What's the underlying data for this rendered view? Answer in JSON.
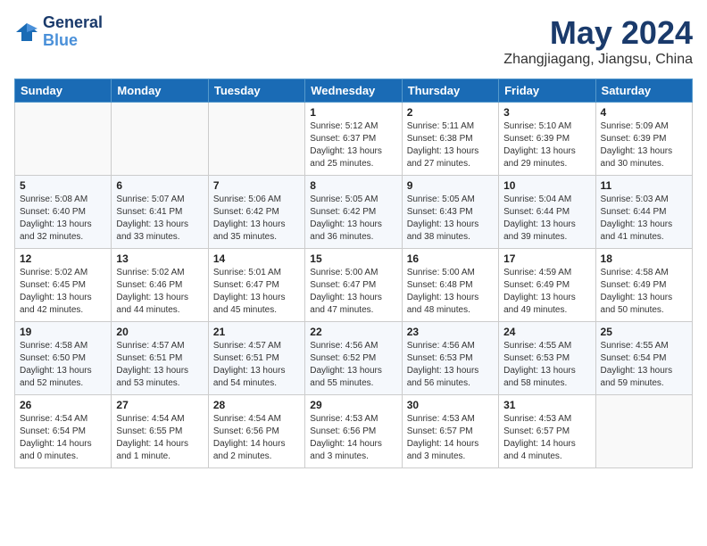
{
  "logo": {
    "line1": "General",
    "line2": "Blue"
  },
  "title": "May 2024",
  "location": "Zhangjiagang, Jiangsu, China",
  "days_header": [
    "Sunday",
    "Monday",
    "Tuesday",
    "Wednesday",
    "Thursday",
    "Friday",
    "Saturday"
  ],
  "weeks": [
    [
      {
        "num": "",
        "info": ""
      },
      {
        "num": "",
        "info": ""
      },
      {
        "num": "",
        "info": ""
      },
      {
        "num": "1",
        "info": "Sunrise: 5:12 AM\nSunset: 6:37 PM\nDaylight: 13 hours\nand 25 minutes."
      },
      {
        "num": "2",
        "info": "Sunrise: 5:11 AM\nSunset: 6:38 PM\nDaylight: 13 hours\nand 27 minutes."
      },
      {
        "num": "3",
        "info": "Sunrise: 5:10 AM\nSunset: 6:39 PM\nDaylight: 13 hours\nand 29 minutes."
      },
      {
        "num": "4",
        "info": "Sunrise: 5:09 AM\nSunset: 6:39 PM\nDaylight: 13 hours\nand 30 minutes."
      }
    ],
    [
      {
        "num": "5",
        "info": "Sunrise: 5:08 AM\nSunset: 6:40 PM\nDaylight: 13 hours\nand 32 minutes."
      },
      {
        "num": "6",
        "info": "Sunrise: 5:07 AM\nSunset: 6:41 PM\nDaylight: 13 hours\nand 33 minutes."
      },
      {
        "num": "7",
        "info": "Sunrise: 5:06 AM\nSunset: 6:42 PM\nDaylight: 13 hours\nand 35 minutes."
      },
      {
        "num": "8",
        "info": "Sunrise: 5:05 AM\nSunset: 6:42 PM\nDaylight: 13 hours\nand 36 minutes."
      },
      {
        "num": "9",
        "info": "Sunrise: 5:05 AM\nSunset: 6:43 PM\nDaylight: 13 hours\nand 38 minutes."
      },
      {
        "num": "10",
        "info": "Sunrise: 5:04 AM\nSunset: 6:44 PM\nDaylight: 13 hours\nand 39 minutes."
      },
      {
        "num": "11",
        "info": "Sunrise: 5:03 AM\nSunset: 6:44 PM\nDaylight: 13 hours\nand 41 minutes."
      }
    ],
    [
      {
        "num": "12",
        "info": "Sunrise: 5:02 AM\nSunset: 6:45 PM\nDaylight: 13 hours\nand 42 minutes."
      },
      {
        "num": "13",
        "info": "Sunrise: 5:02 AM\nSunset: 6:46 PM\nDaylight: 13 hours\nand 44 minutes."
      },
      {
        "num": "14",
        "info": "Sunrise: 5:01 AM\nSunset: 6:47 PM\nDaylight: 13 hours\nand 45 minutes."
      },
      {
        "num": "15",
        "info": "Sunrise: 5:00 AM\nSunset: 6:47 PM\nDaylight: 13 hours\nand 47 minutes."
      },
      {
        "num": "16",
        "info": "Sunrise: 5:00 AM\nSunset: 6:48 PM\nDaylight: 13 hours\nand 48 minutes."
      },
      {
        "num": "17",
        "info": "Sunrise: 4:59 AM\nSunset: 6:49 PM\nDaylight: 13 hours\nand 49 minutes."
      },
      {
        "num": "18",
        "info": "Sunrise: 4:58 AM\nSunset: 6:49 PM\nDaylight: 13 hours\nand 50 minutes."
      }
    ],
    [
      {
        "num": "19",
        "info": "Sunrise: 4:58 AM\nSunset: 6:50 PM\nDaylight: 13 hours\nand 52 minutes."
      },
      {
        "num": "20",
        "info": "Sunrise: 4:57 AM\nSunset: 6:51 PM\nDaylight: 13 hours\nand 53 minutes."
      },
      {
        "num": "21",
        "info": "Sunrise: 4:57 AM\nSunset: 6:51 PM\nDaylight: 13 hours\nand 54 minutes."
      },
      {
        "num": "22",
        "info": "Sunrise: 4:56 AM\nSunset: 6:52 PM\nDaylight: 13 hours\nand 55 minutes."
      },
      {
        "num": "23",
        "info": "Sunrise: 4:56 AM\nSunset: 6:53 PM\nDaylight: 13 hours\nand 56 minutes."
      },
      {
        "num": "24",
        "info": "Sunrise: 4:55 AM\nSunset: 6:53 PM\nDaylight: 13 hours\nand 58 minutes."
      },
      {
        "num": "25",
        "info": "Sunrise: 4:55 AM\nSunset: 6:54 PM\nDaylight: 13 hours\nand 59 minutes."
      }
    ],
    [
      {
        "num": "26",
        "info": "Sunrise: 4:54 AM\nSunset: 6:54 PM\nDaylight: 14 hours\nand 0 minutes."
      },
      {
        "num": "27",
        "info": "Sunrise: 4:54 AM\nSunset: 6:55 PM\nDaylight: 14 hours\nand 1 minute."
      },
      {
        "num": "28",
        "info": "Sunrise: 4:54 AM\nSunset: 6:56 PM\nDaylight: 14 hours\nand 2 minutes."
      },
      {
        "num": "29",
        "info": "Sunrise: 4:53 AM\nSunset: 6:56 PM\nDaylight: 14 hours\nand 3 minutes."
      },
      {
        "num": "30",
        "info": "Sunrise: 4:53 AM\nSunset: 6:57 PM\nDaylight: 14 hours\nand 3 minutes."
      },
      {
        "num": "31",
        "info": "Sunrise: 4:53 AM\nSunset: 6:57 PM\nDaylight: 14 hours\nand 4 minutes."
      },
      {
        "num": "",
        "info": ""
      }
    ]
  ]
}
